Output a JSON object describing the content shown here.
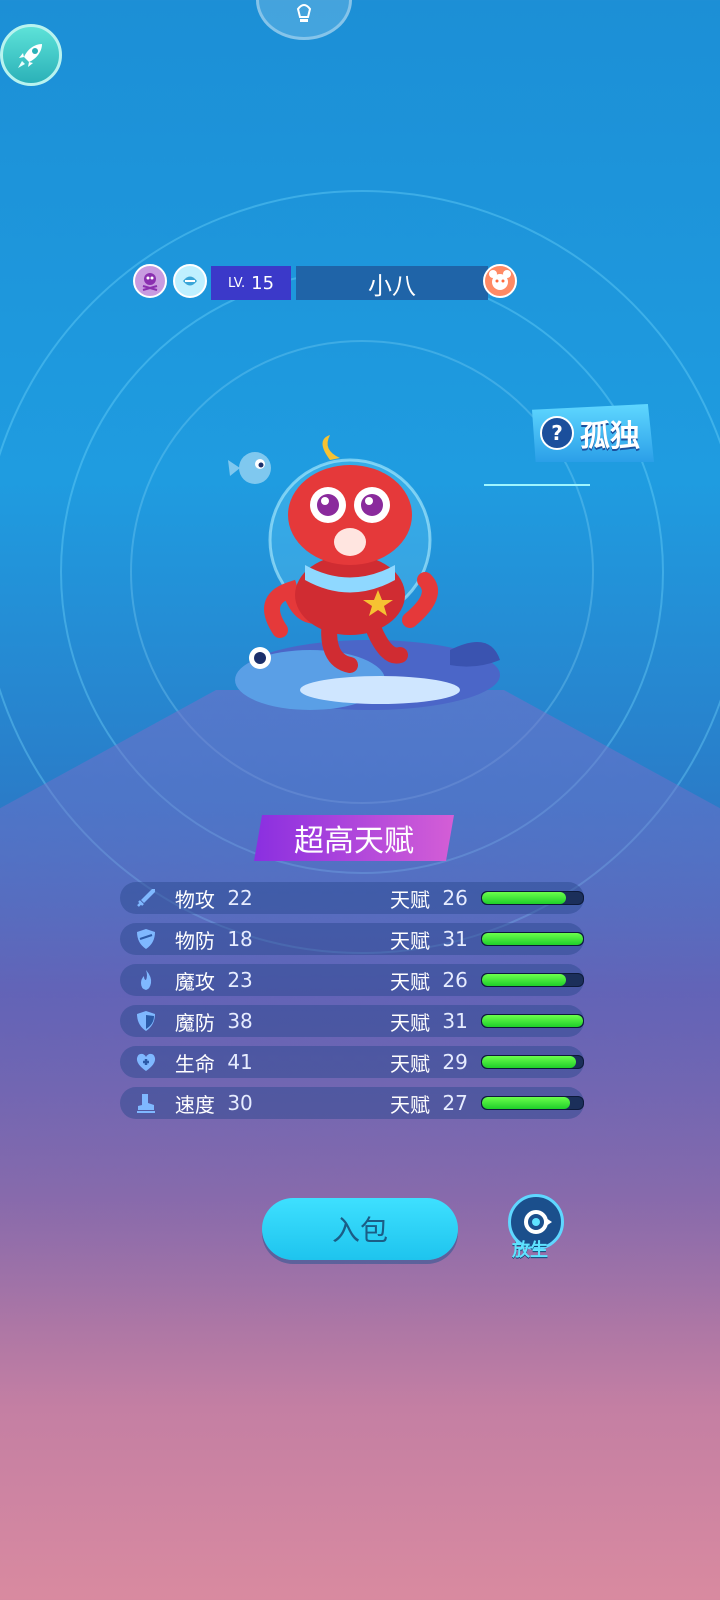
{
  "pet": {
    "level_prefix": "LV.",
    "level": "15",
    "name": "小八",
    "trait": "孤独",
    "trait_question": "?"
  },
  "talent_banner": "超高天赋",
  "talent_label": "天赋",
  "stats": [
    {
      "name": "物攻",
      "value": "22",
      "talent": "26",
      "talent_fraction": 0.83,
      "icon": "sword-icon"
    },
    {
      "name": "物防",
      "value": "18",
      "talent": "31",
      "talent_fraction": 1.0,
      "icon": "shield-icon"
    },
    {
      "name": "魔攻",
      "value": "23",
      "talent": "26",
      "talent_fraction": 0.83,
      "icon": "fire-icon"
    },
    {
      "name": "魔防",
      "value": "38",
      "talent": "31",
      "talent_fraction": 1.0,
      "icon": "magic-shield-icon"
    },
    {
      "name": "生命",
      "value": "41",
      "talent": "29",
      "talent_fraction": 0.93,
      "icon": "heart-plus-icon"
    },
    {
      "name": "速度",
      "value": "30",
      "talent": "27",
      "talent_fraction": 0.87,
      "icon": "boot-icon"
    }
  ],
  "buttons": {
    "bag": "入包",
    "release": "放生"
  },
  "colors": {
    "bar_fill": "#1fcf2a",
    "bag_button": "#1ec4ee",
    "level_box": "#3b39c9"
  }
}
